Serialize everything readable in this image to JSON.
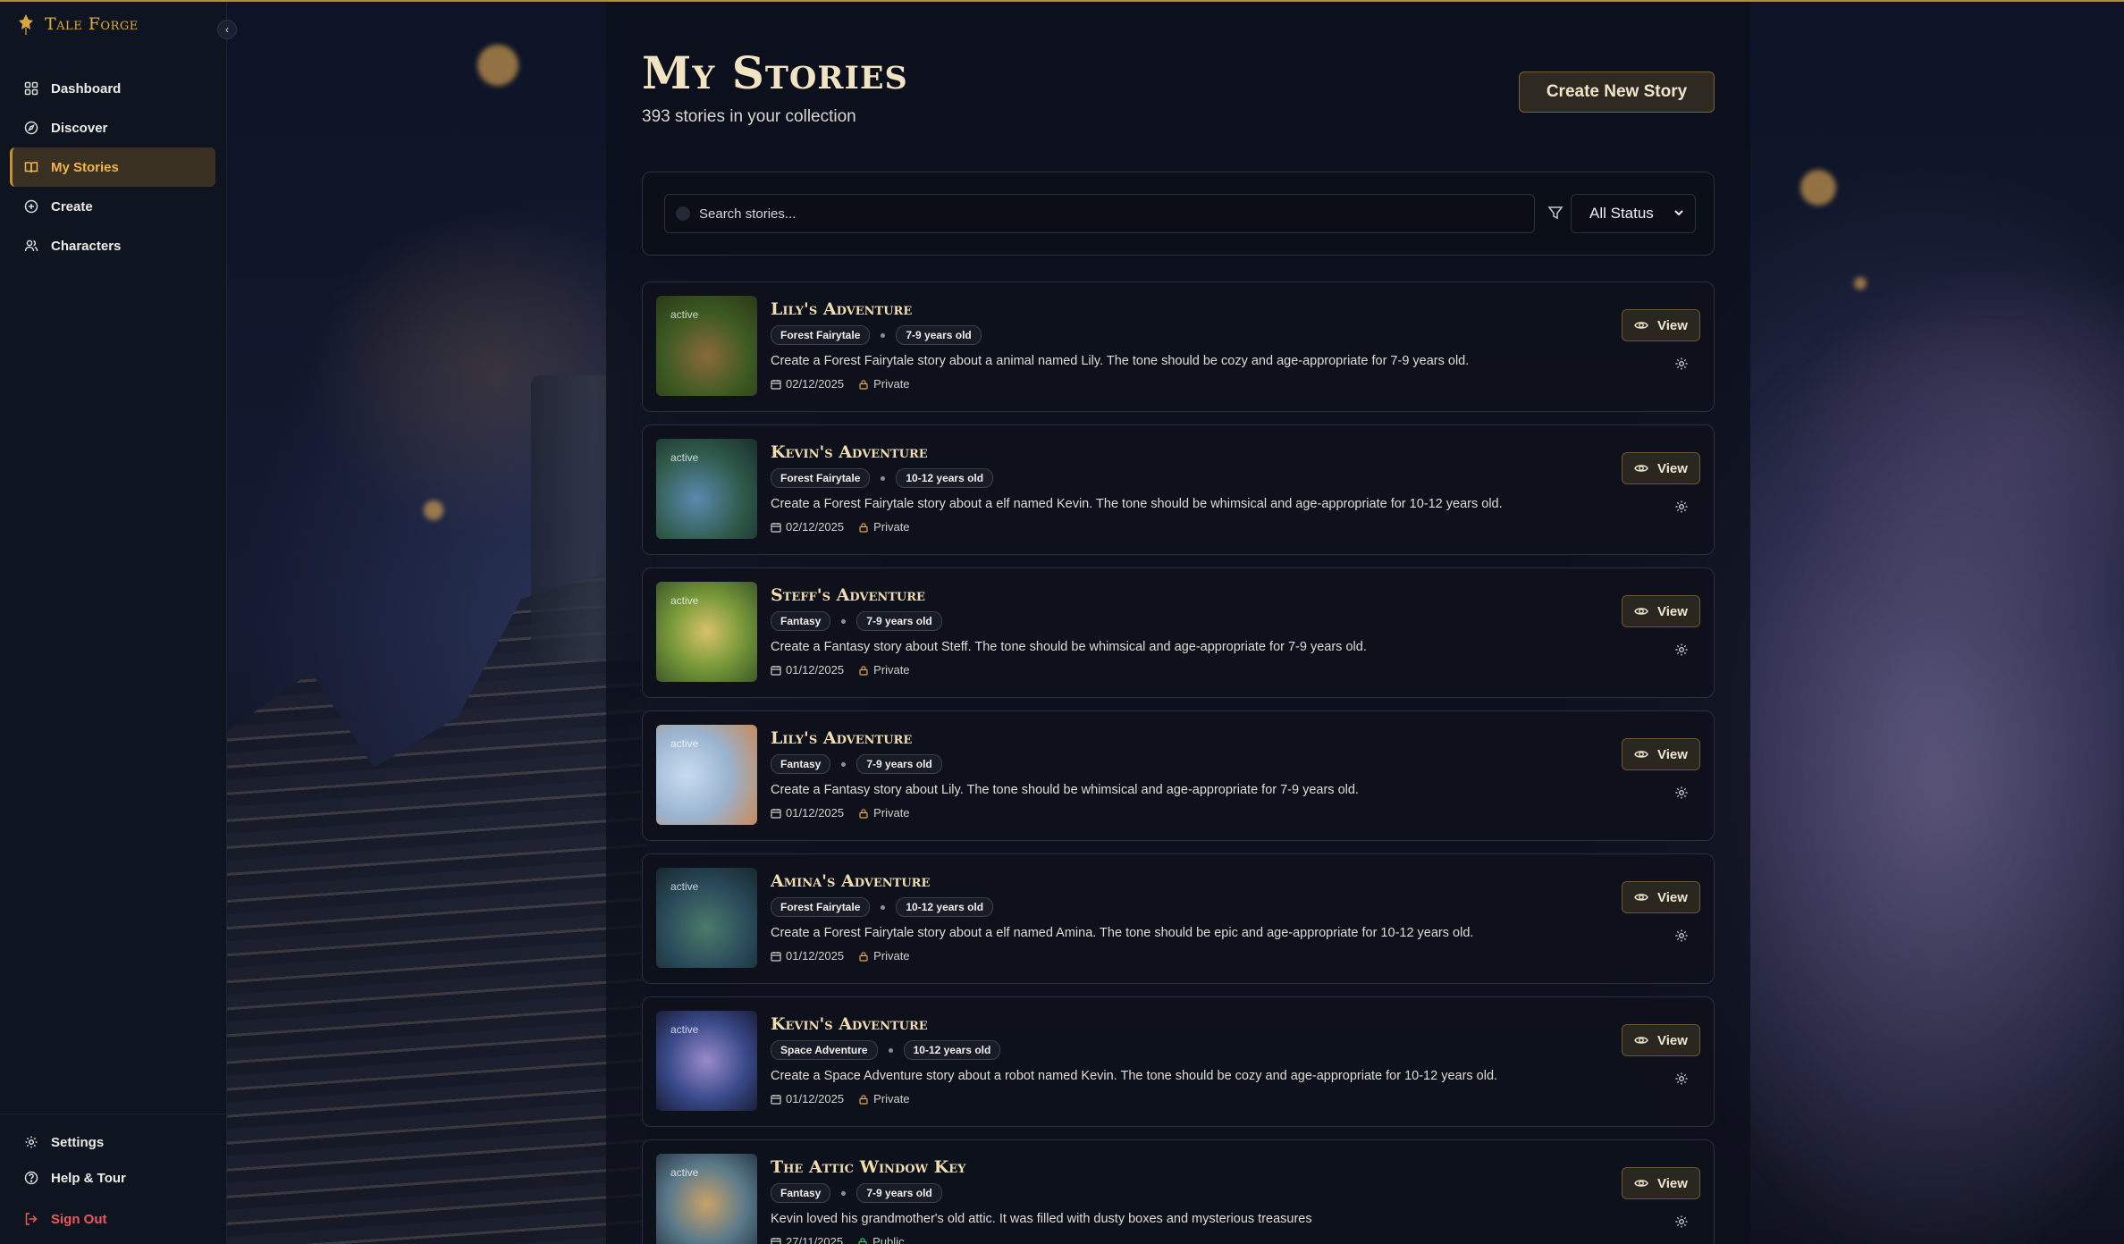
{
  "app": {
    "brand": "Tale Forge",
    "collapse_icon": "chevron-left-icon"
  },
  "sidebar": {
    "items": [
      {
        "label": "Dashboard",
        "icon": "grid-icon",
        "active": false
      },
      {
        "label": "Discover",
        "icon": "compass-icon",
        "active": false
      },
      {
        "label": "My Stories",
        "icon": "book-open-icon",
        "active": true
      },
      {
        "label": "Create",
        "icon": "plus-circle-icon",
        "active": false
      },
      {
        "label": "Characters",
        "icon": "users-icon",
        "active": false
      }
    ],
    "bottom": [
      {
        "label": "Settings",
        "icon": "gear-icon"
      },
      {
        "label": "Help & Tour",
        "icon": "help-circle-icon"
      },
      {
        "label": "Sign Out",
        "icon": "logout-icon"
      }
    ]
  },
  "header": {
    "title": "My Stories",
    "subtitle": "393 stories in your collection",
    "create_label": "Create New Story"
  },
  "filters": {
    "search_placeholder": "Search stories...",
    "status_value": "All Status"
  },
  "colors": {
    "accent": "#e2aa3c",
    "active_bg": "#3a3022",
    "signout": "#f0565a",
    "public": "#3cc46a"
  },
  "stories": [
    {
      "title": "Lily's Adventure",
      "genre": "Forest Fairytale",
      "age": "7-9 years old",
      "description": "Create a Forest Fairytale story about a animal named Lily. The tone should be cozy and age-appropriate for 7-9 years old.",
      "date": "02/12/2025",
      "visibility": "Private",
      "status": "active",
      "view_label": "View"
    },
    {
      "title": "Kevin's Adventure",
      "genre": "Forest Fairytale",
      "age": "10-12 years old",
      "description": "Create a Forest Fairytale story about a elf named Kevin. The tone should be whimsical and age-appropriate for 10-12 years old.",
      "date": "02/12/2025",
      "visibility": "Private",
      "status": "active",
      "view_label": "View"
    },
    {
      "title": "Steff's Adventure",
      "genre": "Fantasy",
      "age": "7-9 years old",
      "description": "Create a Fantasy story about Steff. The tone should be whimsical and age-appropriate for 7-9 years old.",
      "date": "01/12/2025",
      "visibility": "Private",
      "status": "active",
      "view_label": "View"
    },
    {
      "title": "Lily's Adventure",
      "genre": "Fantasy",
      "age": "7-9 years old",
      "description": "Create a Fantasy story about Lily. The tone should be whimsical and age-appropriate for 7-9 years old.",
      "date": "01/12/2025",
      "visibility": "Private",
      "status": "active",
      "view_label": "View"
    },
    {
      "title": "Amina's Adventure",
      "genre": "Forest Fairytale",
      "age": "10-12 years old",
      "description": "Create a Forest Fairytale story about a elf named Amina. The tone should be epic and age-appropriate for 10-12 years old.",
      "date": "01/12/2025",
      "visibility": "Private",
      "status": "active",
      "view_label": "View"
    },
    {
      "title": "Kevin's Adventure",
      "genre": "Space Adventure",
      "age": "10-12 years old",
      "description": "Create a Space Adventure story about a robot named Kevin. The tone should be cozy and age-appropriate for 10-12 years old.",
      "date": "01/12/2025",
      "visibility": "Private",
      "status": "active",
      "view_label": "View"
    },
    {
      "title": "The Attic Window Key",
      "genre": "Fantasy",
      "age": "7-9 years old",
      "description": "Kevin loved his grandmother's old attic. It was filled with dusty boxes and mysterious treasures",
      "date": "27/11/2025",
      "visibility": "Public",
      "status": "active",
      "view_label": "View"
    }
  ]
}
